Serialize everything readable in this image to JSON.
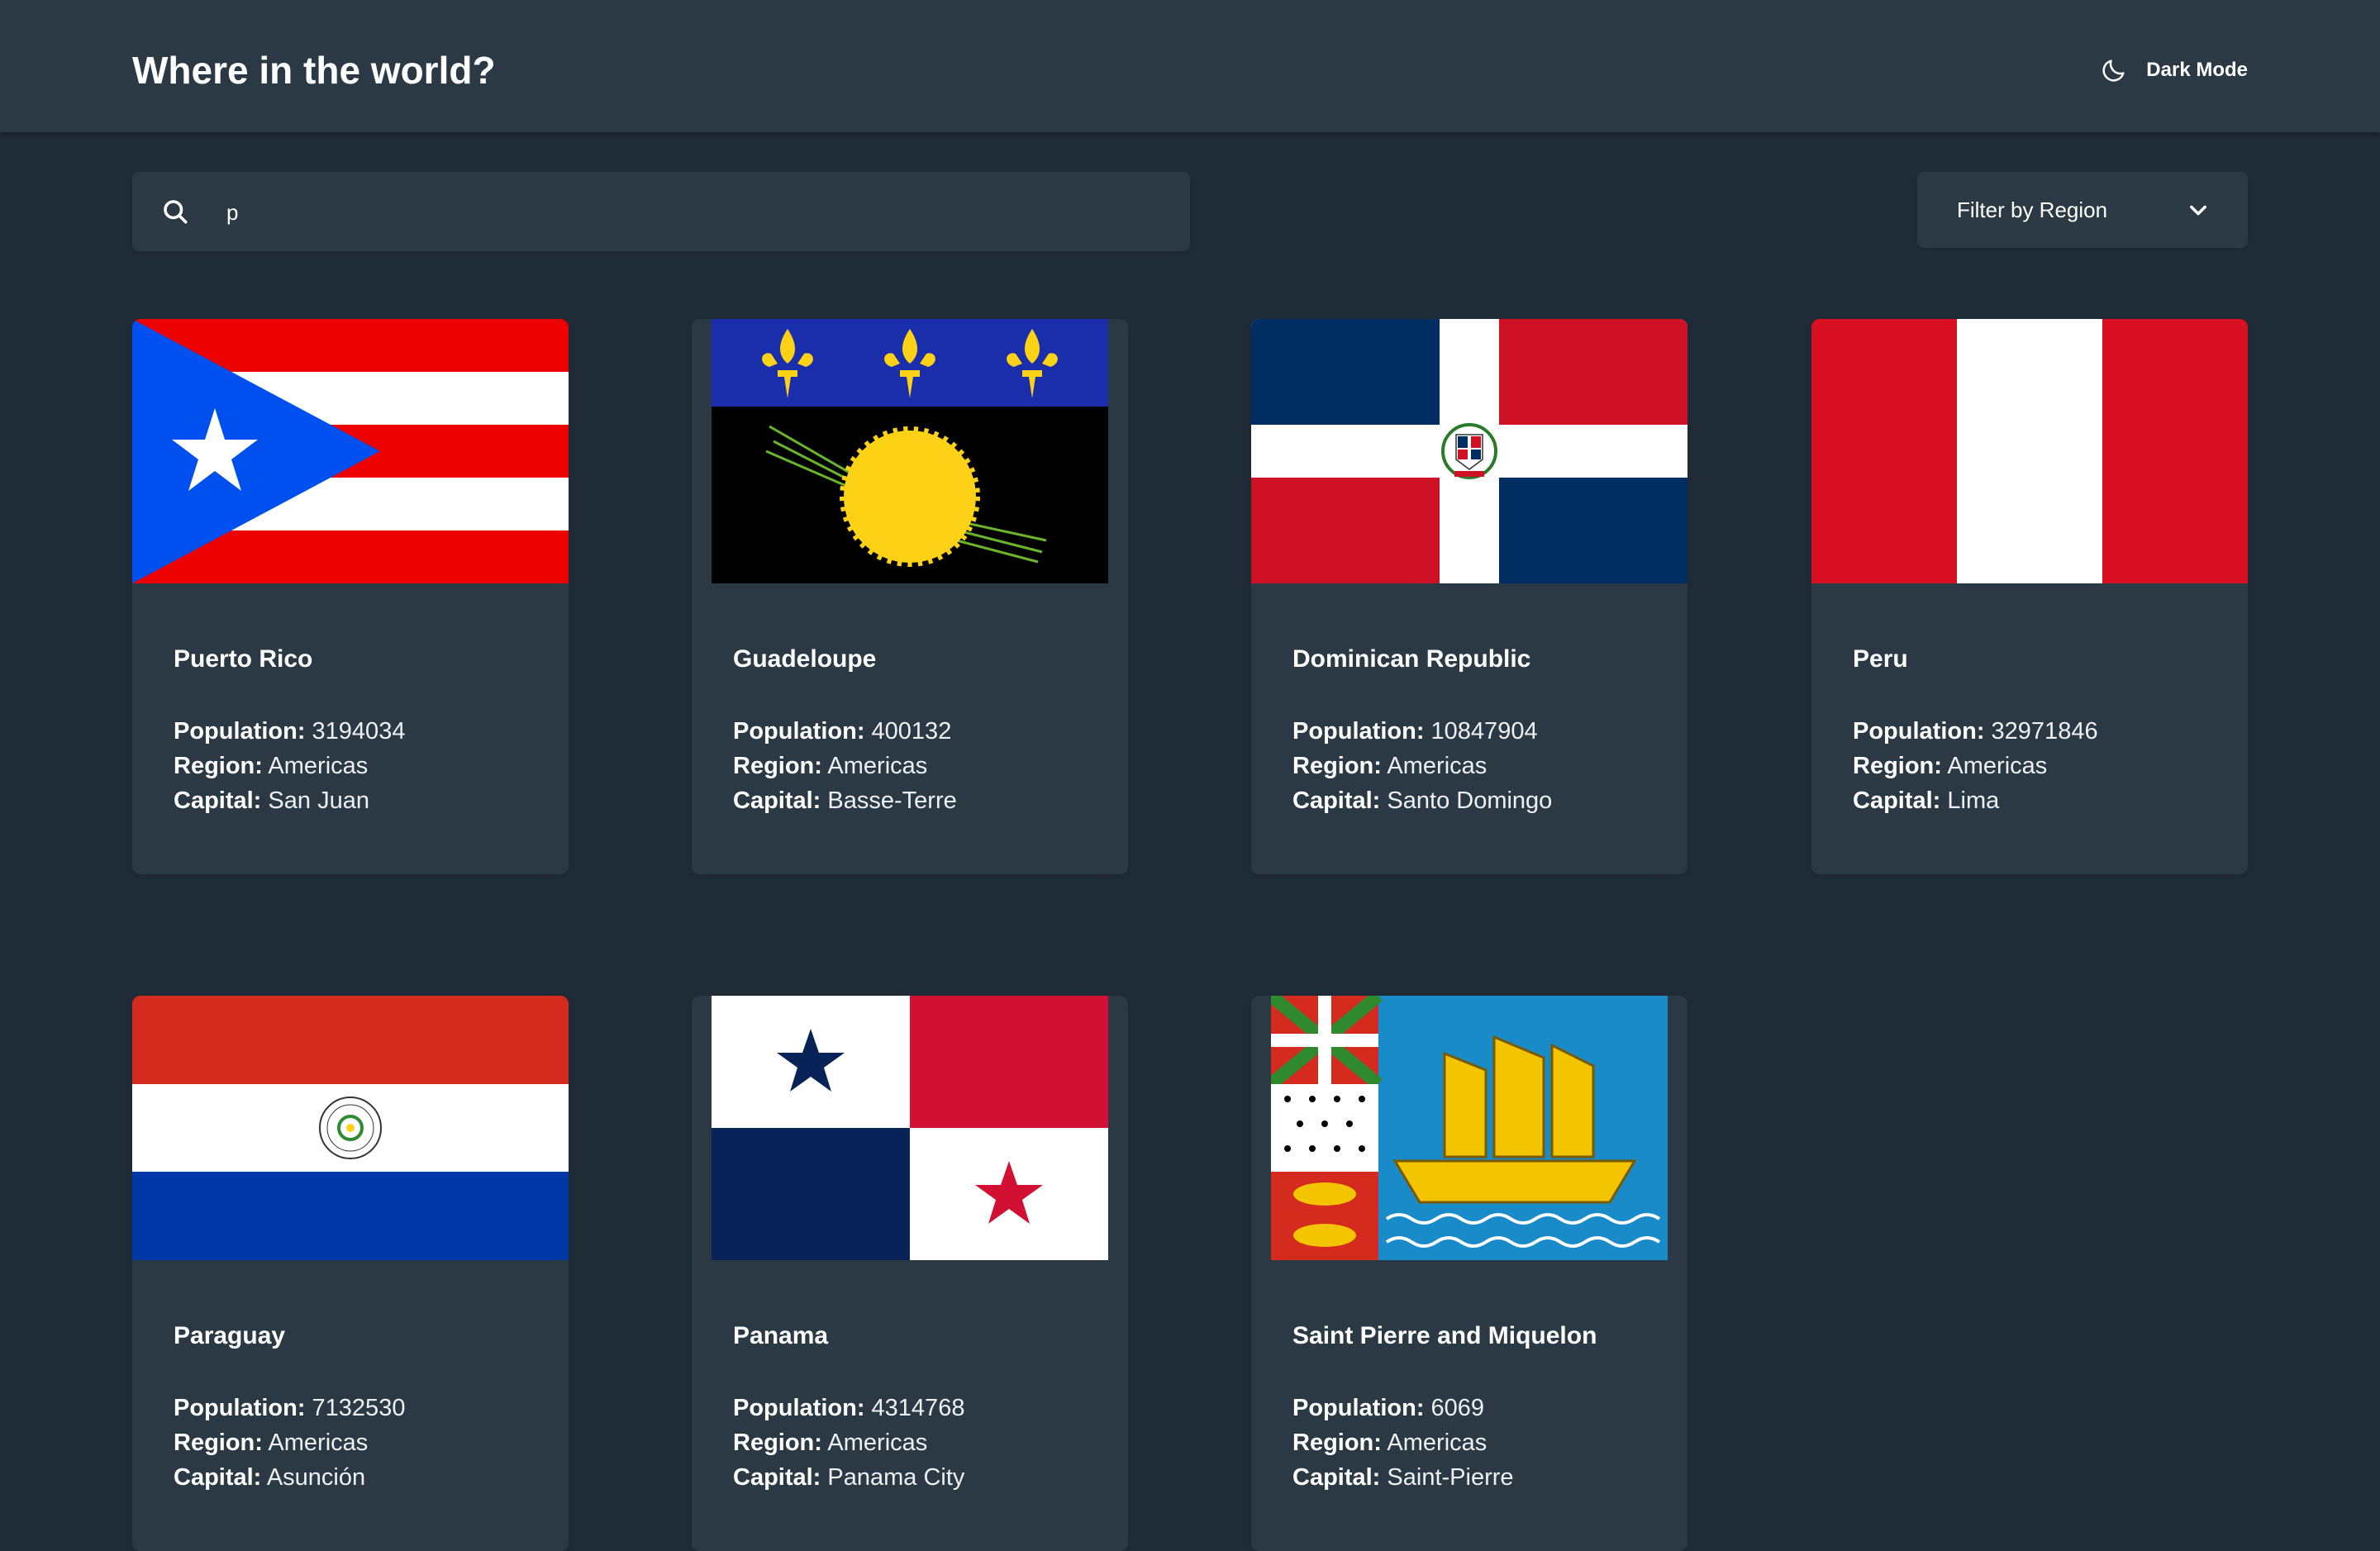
{
  "header": {
    "title": "Where in the world?",
    "mode_toggle": {
      "label": "Dark Mode",
      "icon": "moon-icon"
    }
  },
  "search": {
    "value": "p",
    "icon": "search-icon"
  },
  "filter": {
    "label": "Filter by Region",
    "icon": "chevron-down-icon"
  },
  "labels": {
    "population": "Population:",
    "region": "Region:",
    "capital": "Capital:"
  },
  "countries": [
    {
      "name": "Puerto Rico",
      "population": "3194034",
      "region": "Americas",
      "capital": "San Juan",
      "flag": "puerto-rico-flag"
    },
    {
      "name": "Guadeloupe",
      "population": "400132",
      "region": "Americas",
      "capital": "Basse-Terre",
      "flag": "guadeloupe-flag"
    },
    {
      "name": "Dominican Republic",
      "population": "10847904",
      "region": "Americas",
      "capital": "Santo Domingo",
      "flag": "dominican-republic-flag"
    },
    {
      "name": "Peru",
      "population": "32971846",
      "region": "Americas",
      "capital": "Lima",
      "flag": "peru-flag"
    },
    {
      "name": "Paraguay",
      "population": "7132530",
      "region": "Americas",
      "capital": "Asunción",
      "flag": "paraguay-flag"
    },
    {
      "name": "Panama",
      "population": "4314768",
      "region": "Americas",
      "capital": "Panama City",
      "flag": "panama-flag"
    },
    {
      "name": "Saint Pierre and Miquelon",
      "population": "6069",
      "region": "Americas",
      "capital": "Saint-Pierre",
      "flag": "saint-pierre-and-miquelon-flag"
    }
  ],
  "colors": {
    "background": "#202c37",
    "elements": "#2b3945",
    "text": "#ffffff"
  }
}
